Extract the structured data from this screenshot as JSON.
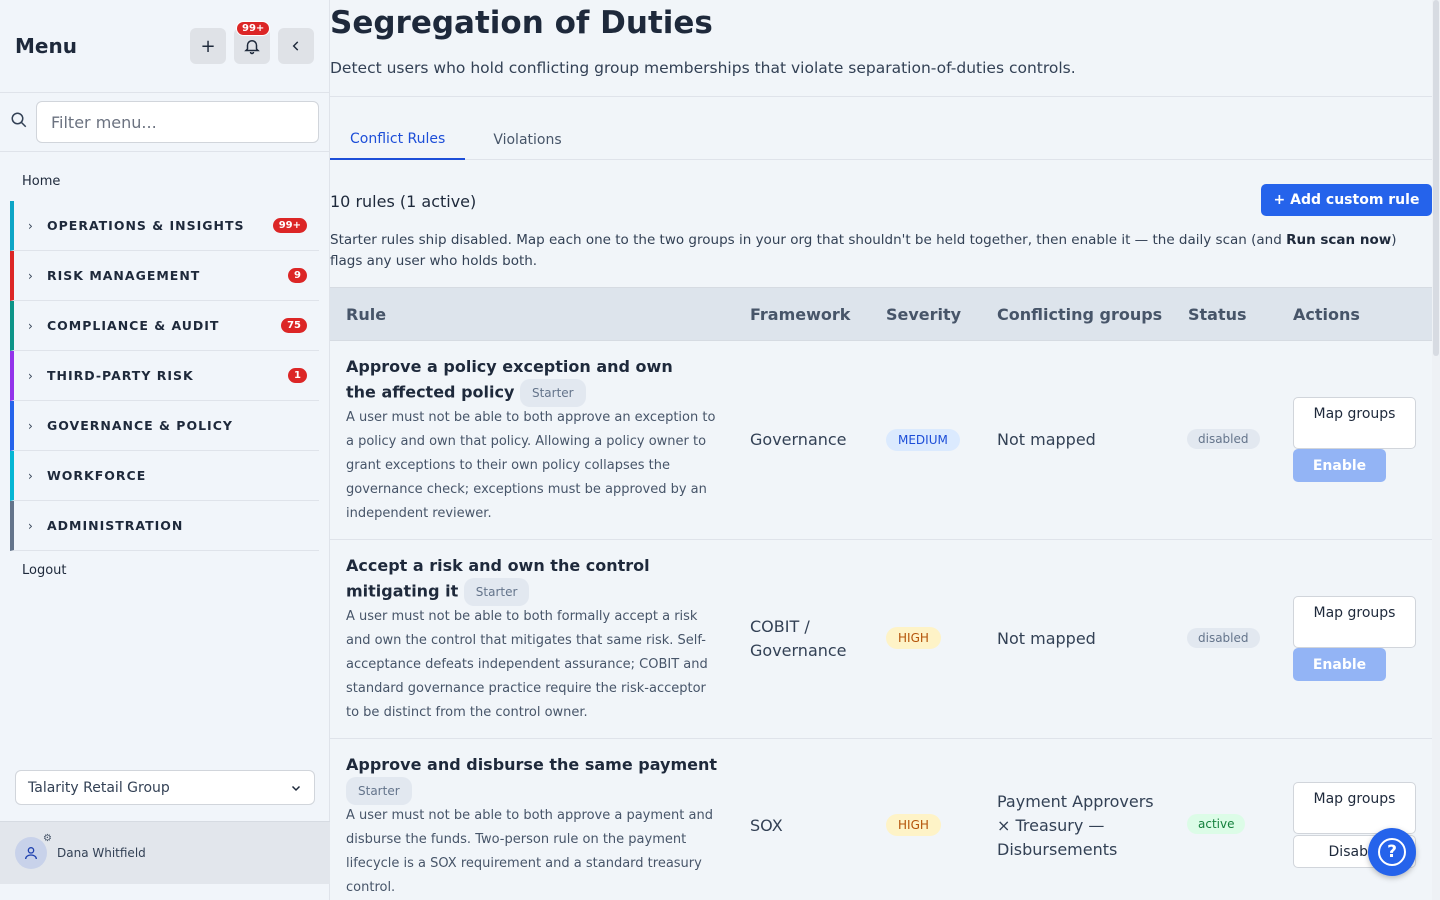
{
  "sidebar": {
    "title": "Menu",
    "notif_count": "99+",
    "search_placeholder": "Filter menu...",
    "home": "Home",
    "sections": [
      {
        "label": "OPERATIONS & INSIGHTS",
        "count": "99+",
        "color": "#0ea5c6"
      },
      {
        "label": "RISK MANAGEMENT",
        "count": "9",
        "color": "#dc2626"
      },
      {
        "label": "COMPLIANCE & AUDIT",
        "count": "75",
        "color": "#0d9488"
      },
      {
        "label": "THIRD-PARTY RISK",
        "count": "1",
        "color": "#9333ea"
      },
      {
        "label": "GOVERNANCE & POLICY",
        "count": "",
        "color": "#2563eb"
      },
      {
        "label": "WORKFORCE",
        "count": "",
        "color": "#06b6d4"
      },
      {
        "label": "ADMINISTRATION",
        "count": "",
        "color": "#64748b"
      }
    ],
    "logout": "Logout",
    "org": "Talarity Retail Group",
    "user": "Dana Whitfield"
  },
  "page": {
    "title": "Segregation of Duties",
    "subtitle": "Detect users who hold conflicting group memberships that violate separation-of-duties controls."
  },
  "tabs": [
    "Conflict Rules",
    "Violations"
  ],
  "toolbar": {
    "count_text": "10 rules (1 active)",
    "add_label": "+ Add custom rule"
  },
  "note": {
    "part1": "Starter rules ship disabled. Map each one to the two groups in your org that shouldn't be held together, then enable it — the daily scan (and ",
    "bold": "Run scan now",
    "part2": ") flags any user who holds both."
  },
  "table": {
    "headers": [
      "Rule",
      "Framework",
      "Severity",
      "Conflicting groups",
      "Status",
      "Actions"
    ],
    "map_label": "Map groups",
    "starter_label": "Starter",
    "rows": [
      {
        "title": "Approve a policy exception and own the affected policy",
        "description": "A user must not be able to both approve an exception to a policy and own that policy. Allowing a policy owner to grant exceptions to their own policy collapses the governance check; exceptions must be approved by an independent reviewer.",
        "framework": "Governance",
        "severity": "MEDIUM",
        "groups": "Not mapped",
        "status": "disabled",
        "toggle": "Enable"
      },
      {
        "title": "Accept a risk and own the control mitigating it",
        "description": "A user must not be able to both formally accept a risk and own the control that mitigates that same risk. Self-acceptance defeats independent assurance; COBIT and standard governance practice require the risk-acceptor to be distinct from the control owner.",
        "framework": "COBIT / Governance",
        "severity": "HIGH",
        "groups": "Not mapped",
        "status": "disabled",
        "toggle": "Enable"
      },
      {
        "title": "Approve and disburse the same payment",
        "description": "A user must not be able to both approve a payment and disburse the funds. Two-person rule on the payment lifecycle is a SOX requirement and a standard treasury control.",
        "framework": "SOX",
        "severity": "HIGH",
        "groups": "Payment Approvers × Treasury — Disbursements",
        "status": "active",
        "toggle": "Disable"
      }
    ]
  }
}
